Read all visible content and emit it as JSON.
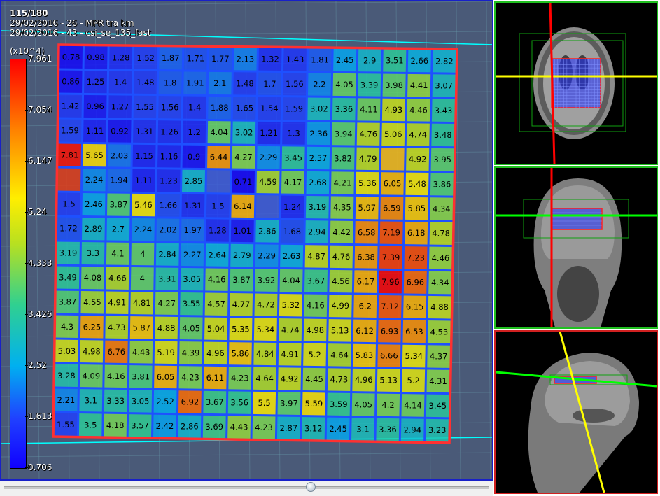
{
  "overlay": {
    "slice_counter": "115/180",
    "series_1": "29/02/2016 - 26 - MPR tra km",
    "series_2": "29/02/2016 - 43 - csi_se_135_fast",
    "scale_unit": "(x10^4)"
  },
  "colorbar": {
    "labels": [
      "7.961",
      "7.054",
      "6.147",
      "5.24",
      "4.333",
      "3.426",
      "2.52",
      "1.613",
      "0.706"
    ],
    "colors": {
      "max": "#ff0000",
      "mid": "#ffee00",
      "low": "#00b0f0",
      "min": "#1000ff"
    }
  },
  "grid": {
    "rows": [
      [
        "0.78",
        "0.98",
        "1.28",
        "1.52",
        "1.87",
        "1.71",
        "1.77",
        "2.13",
        "1.32",
        "1.43",
        "1.81",
        "2.45",
        "2.9",
        "3.51",
        "2.66",
        "2.82"
      ],
      [
        "0.86",
        "1.25",
        "1.4",
        "1.48",
        "1.8",
        "1.91",
        "2.1",
        "1.48",
        "1.7",
        "1.56",
        "2.2",
        "4.05",
        "3.39",
        "3.98",
        "4.41",
        "3.07"
      ],
      [
        "1.42",
        "0.96",
        "1.27",
        "1.55",
        "1.56",
        "1.4",
        "1.88",
        "1.65",
        "1.54",
        "1.59",
        "3.02",
        "3.36",
        "4.11",
        "4.93",
        "4.46",
        "3.43"
      ],
      [
        "1.59",
        "1.11",
        "0.92",
        "1.31",
        "1.26",
        "1.2",
        "4.04",
        "3.02",
        "1.21",
        "1.3",
        "2.36",
        "3.94",
        "4.76",
        "5.06",
        "4.74",
        "3.48"
      ],
      [
        "7.81",
        "5.65",
        "2.03",
        "1.15",
        "1.16",
        "0.9",
        "6.44",
        "4.27",
        "2.29",
        "3.45",
        "2.57",
        "3.82",
        "4.79",
        "",
        "4.92",
        "3.95"
      ],
      [
        "",
        "2.24",
        "1.94",
        "1.11",
        "1.23",
        "2.85",
        "",
        "0.71",
        "4.59",
        "4.17",
        "2.68",
        "4.21",
        "5.36",
        "6.05",
        "5.48",
        "3.86"
      ],
      [
        "1.5",
        "2.46",
        "3.87",
        "5.46",
        "1.66",
        "1.31",
        "1.5",
        "6.14",
        "",
        "1.24",
        "3.19",
        "4.35",
        "5.97",
        "6.59",
        "5.85",
        "4.34"
      ],
      [
        "1.72",
        "2.89",
        "2.7",
        "2.24",
        "2.02",
        "1.97",
        "1.28",
        "1.01",
        "2.86",
        "1.68",
        "2.94",
        "4.42",
        "6.58",
        "7.19",
        "6.18",
        "4.78"
      ],
      [
        "3.19",
        "3.3",
        "4.1",
        "4",
        "2.84",
        "2.27",
        "2.64",
        "2.79",
        "2.29",
        "2.63",
        "4.87",
        "4.76",
        "6.38",
        "7.39",
        "7.23",
        "4.46"
      ],
      [
        "3.49",
        "4.08",
        "4.66",
        "4",
        "3.31",
        "3.05",
        "4.16",
        "3.87",
        "3.92",
        "4.04",
        "3.67",
        "4.56",
        "6.17",
        "7.96",
        "6.96",
        "4.34"
      ],
      [
        "3.87",
        "4.55",
        "4.91",
        "4.81",
        "4.27",
        "3.55",
        "4.57",
        "4.77",
        "4.72",
        "5.32",
        "4.16",
        "4.99",
        "6.2",
        "7.12",
        "6.15",
        "4.88"
      ],
      [
        "4.3",
        "6.25",
        "4.73",
        "5.87",
        "4.88",
        "4.05",
        "5.04",
        "5.35",
        "5.34",
        "4.74",
        "4.98",
        "5.13",
        "6.12",
        "6.93",
        "6.53",
        "4.53"
      ],
      [
        "5.03",
        "4.98",
        "6.76",
        "4.43",
        "5.19",
        "4.39",
        "4.96",
        "5.86",
        "4.84",
        "4.91",
        "5.2",
        "4.64",
        "5.83",
        "6.66",
        "5.34",
        "4.37"
      ],
      [
        "3.28",
        "4.09",
        "4.16",
        "3.81",
        "6.05",
        "4.23",
        "6.11",
        "4.23",
        "4.64",
        "4.92",
        "4.45",
        "4.73",
        "4.96",
        "5.13",
        "5.2",
        "4.31"
      ],
      [
        "2.21",
        "3.1",
        "3.33",
        "3.05",
        "2.52",
        "6.92",
        "3.67",
        "3.56",
        "5.5",
        "3.97",
        "5.59",
        "3.59",
        "4.05",
        "4.2",
        "4.14",
        "3.45"
      ],
      [
        "1.55",
        "3.5",
        "4.18",
        "3.57",
        "2.42",
        "2.86",
        "3.69",
        "4.43",
        "4.23",
        "2.87",
        "3.12",
        "2.45",
        "3.1",
        "3.36",
        "2.94",
        "3.23"
      ]
    ],
    "line_color": "#1e50ff",
    "roi_color": "#ff3030"
  },
  "side_views": {
    "axial": {
      "frame_color": "#20c020",
      "lines": [
        "yellow",
        "red"
      ]
    },
    "coronal": {
      "frame_color": "#20c020",
      "lines": [
        "green",
        "red"
      ]
    },
    "sagittal": {
      "frame_color": "#d02020",
      "lines": [
        "green",
        "yellow"
      ]
    }
  },
  "slider": {
    "position": 0.63
  }
}
